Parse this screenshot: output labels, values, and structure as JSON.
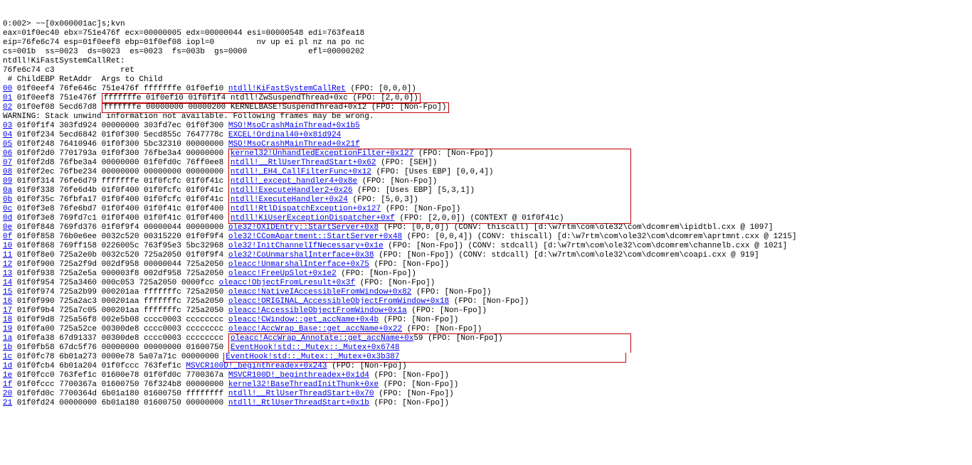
{
  "prompt": "0:002> ~~[0x000001ac]s;kvn",
  "regs": [
    "eax=01f0ec40 ebx=751e476f ecx=00000005 edx=00000044 esi=00000548 edi=763fea18",
    "eip=76fe6c74 esp=01f0eef8 ebp=01f0ef08 iopl=0         nv up ei pl nz na po nc",
    "cs=001b  ss=0023  ds=0023  es=0023  fs=003b  gs=0000             efl=00000202"
  ],
  "sym": "ntdll!KiFastSystemCallRet:",
  "dis": "76fe6c74 c3              ret",
  "hdr": " # ChildEBP RetAddr  Args to Child",
  "warn": "WARNING: Stack unwind information not available. Following frames may be wrong.",
  "rows": [
    {
      "n": "00",
      "c": "01f0eef4 76fe646c 751e476f fffffffe 01f0ef10 ",
      "r": "ntdll!KiFastSystemCallRet",
      "t": " (FPO: [0,0,0])"
    },
    {
      "n": "01",
      "c": "01f0eef8 751e476f ",
      "box": "fffffffe 01f0ef10 01f0f1f4 ntdll!ZwSuspendThread+0xc (FPO: [2,0,0])",
      "r": "",
      "t": ""
    },
    {
      "n": "02",
      "c": "01f0ef08 5ecd67d8 ",
      "box": "fffffffe 00000000 00000200 KERNELBASE!SuspendThread+0x12 (FPO: [Non-Fpo])",
      "r": "",
      "t": ""
    },
    {
      "warnrow": true
    },
    {
      "n": "03",
      "c": "01f0f1f4 303fd924 00000000 303fd7ec 01f0f300 ",
      "r": "MSO!MsoCrashMainThread+0x1b5",
      "t": ""
    },
    {
      "n": "04",
      "c": "01f0f234 5ecd6842 01f0f300 5ecd855c 7647778c ",
      "r": "EXCEL!Ordinal40+0x81d924",
      "t": ""
    },
    {
      "n": "05",
      "c": "01f0f248 76410946 01f0f300 5bc32310 00000000 ",
      "r": "MSO!MsoCrashMainThread+0x21f",
      "t": ""
    },
    {
      "n": "06",
      "c": "01f0f2d0 7701793a 01f0f300 76fbe3a4 00000000 ",
      "r": "kernel32!UnhandledExceptionFilter+0x127",
      "t": " (FPO: [Non-Fpo])",
      "grp": "a",
      "gs": true
    },
    {
      "n": "07",
      "c": "01f0f2d8 76fbe3a4 00000000 01f0fd0c 76ff0ee8 ",
      "r": "ntdll!__RtlUserThreadStart+0x62",
      "t": " (FPO: [SEH])",
      "grp": "a"
    },
    {
      "n": "08",
      "c": "01f0f2ec 76fbe234 00000000 00000000 00000000 ",
      "r": "ntdll!_EH4_CallFilterFunc+0x12",
      "t": " (FPO: [Uses EBP] [0,0,4])",
      "grp": "a"
    },
    {
      "n": "09",
      "c": "01f0f314 76fe6d79 fffffffe 01f0fcfc 01f0f41c ",
      "r": "ntdll!_except_handler4+0x8e",
      "t": " (FPO: [Non-Fpo])",
      "grp": "a"
    },
    {
      "n": "0a",
      "c": "01f0f338 76fe6d4b 01f0f400 01f0fcfc 01f0f41c ",
      "r": "ntdll!ExecuteHandler2+0x26",
      "t": " (FPO: [Uses EBP] [5,3,1])",
      "grp": "a"
    },
    {
      "n": "0b",
      "c": "01f0f35c 76fbfa17 01f0f400 01f0fcfc 01f0f41c ",
      "r": "ntdll!ExecuteHandler+0x24",
      "t": " (FPO: [5,0,3])",
      "grp": "a"
    },
    {
      "n": "0c",
      "c": "01f0f3e8 76fe6bd7 01f0f400 01f0f41c 01f0f400 ",
      "r": "ntdll!RtlDispatchException+0x127",
      "t": " (FPO: [Non-Fpo])",
      "grp": "a"
    },
    {
      "n": "0d",
      "c": "01f0f3e8 769fd7c1 01f0f400 01f0f41c 01f0f400 ",
      "r": "ntdll!KiUserExceptionDispatcher+0xf",
      "t": " (FPO: [2,0,0]) (CONTEXT @ 01f0f41c)",
      "grp": "a",
      "ge": true
    },
    {
      "n": "0e",
      "c": "01f0f848 769fd376 01f0f9f4 00000044 00000000 ",
      "r": "ole32!OXIDEntry::StartServer+0x8",
      "t": " (FPO: [0,0,0]) (CONV: thiscall) [d:\\w7rtm\\com\\ole32\\com\\dcomrem\\ipidtbl.cxx @ 1097]"
    },
    {
      "n": "0f",
      "c": "01f0f858 76b0e6ee 0032c520 00315220 01f0f9f4 ",
      "r": "ole32!CComApartment::StartServer+0x48",
      "t": " (FPO: [0,0,4]) (CONV: thiscall) [d:\\w7rtm\\com\\ole32\\com\\dcomrem\\aprtmnt.cxx @ 1215]"
    },
    {
      "n": "10",
      "c": "01f0f868 769ff158 0226005c 763f95e3 5bc32968 ",
      "r": "ole32!InitChannelIfNecessary+0x1e",
      "t": " (FPO: [Non-Fpo]) (CONV: stdcall) [d:\\w7rtm\\com\\ole32\\com\\dcomrem\\channelb.cxx @ 1021]"
    },
    {
      "n": "11",
      "c": "01f0f8e0 725a2e0b 0032c520 725a2050 01f0f9f4 ",
      "r": "ole32!CoUnmarshalInterface+0x38",
      "t": " (FPO: [Non-Fpo]) (CONV: stdcall) [d:\\w7rtm\\com\\ole32\\com\\dcomrem\\coapi.cxx @ 919]"
    },
    {
      "n": "12",
      "c": "01f0f900 725a2f9d 002df958 00000044 725a2050 ",
      "r": "oleacc!UnmarshalInterface+0x75",
      "t": " (FPO: [Non-Fpo])"
    },
    {
      "n": "13",
      "c": "01f0f938 725a2e5a 000003f8 002df958 725a2050 ",
      "r": "oleacc!FreeUpSlot+0x1e2",
      "t": " (FPO: [Non-Fpo])"
    },
    {
      "n": "14",
      "c": "01f0f954 725a3460 000c053 725a2050 0000fcc ",
      "r": "oleacc!ObjectFromLresult+0x3f",
      "t": " (FPO: [Non-Fpo])"
    },
    {
      "n": "15",
      "c": "01f0f974 725a2b99 000201aa fffffffc 725a2050 ",
      "r": "oleacc!NativeIAccessibleFromWindow+0x82",
      "t": " (FPO: [Non-Fpo])"
    },
    {
      "n": "16",
      "c": "01f0f990 725a2ac3 000201aa fffffffc 725a2050 ",
      "r": "oleacc!ORIGINAL_AccessibleObjectFromWindow+0x18",
      "t": " (FPO: [Non-Fpo])"
    },
    {
      "n": "17",
      "c": "01f0f9b4 725a7c05 000201aa fffffffc 725a2050 ",
      "r": "oleacc!AccessibleObjectFromWindow+0x1a",
      "t": " (FPO: [Non-Fpo])"
    },
    {
      "n": "18",
      "c": "01f0f9d8 725a56f8 002e5b08 cccc0003 cccccccc ",
      "r": "oleacc!CWindow::get_accName+0x4b",
      "t": " (FPO: [Non-Fpo])"
    },
    {
      "n": "19",
      "c": "01f0fa00 725a52ce 00300de8 cccc0003 cccccccc ",
      "r": "oleacc!AccWrap_Base::get_accName+0x22",
      "t": " (FPO: [Non-Fpo])"
    },
    {
      "n": "1a",
      "c": "01f0fa38 67d91337 00300de8 cccc0003 cccccccc ",
      "r": "oleacc!AccWrap_Annotate::get_accName+0x",
      "t": "59 (FPO: [Non-Fpo])",
      "grp": "b",
      "gs": true
    },
    {
      "n": "1b",
      "c": "01f0fb58 67dc5f76 00000000 00000000 01600750 ",
      "r": "EventHook!std::_Mutex::_Mutex+0x6748",
      "t": "",
      "grp": "b"
    },
    {
      "n": "1c",
      "c": "01f0fc78 6b01a273 0000e78 5a07a71c 00000000 ",
      "r": "EventHook!std::_Mutex::_Mutex+0x3b387",
      "t": "",
      "grp": "b",
      "ge": true
    },
    {
      "n": "1d",
      "c": "01f0fcb4 6b01a204 01f0fccc 763fef1c ",
      "r": "MSVCR100D!_beginthreadex+0x243",
      "t": " (FPO: [Non-Fpo])"
    },
    {
      "n": "1e",
      "c": "01f0fcc0 763fef1c 01600e78 01f0fd0c 7700367a ",
      "r": "MSVCR100D!_beginthreadex+0x1d4",
      "t": " (FPO: [Non-Fpo])"
    },
    {
      "n": "1f",
      "c": "01f0fccc 7700367a 01600750 76f324b8 00000000 ",
      "r": "kernel32!BaseThreadInitThunk+0xe",
      "t": " (FPO: [Non-Fpo])"
    },
    {
      "n": "20",
      "c": "01f0fd0c 7700364d 6b01a180 01600750 ffffffff ",
      "r": "ntdll!__RtlUserThreadStart+0x70",
      "t": " (FPO: [Non-Fpo])"
    },
    {
      "n": "21",
      "c": "01f0fd24 00000000 6b01a180 01600750 00000000 ",
      "r": "ntdll!_RtlUserThreadStart+0x1b",
      "t": " (FPO: [Non-Fpo])"
    }
  ]
}
